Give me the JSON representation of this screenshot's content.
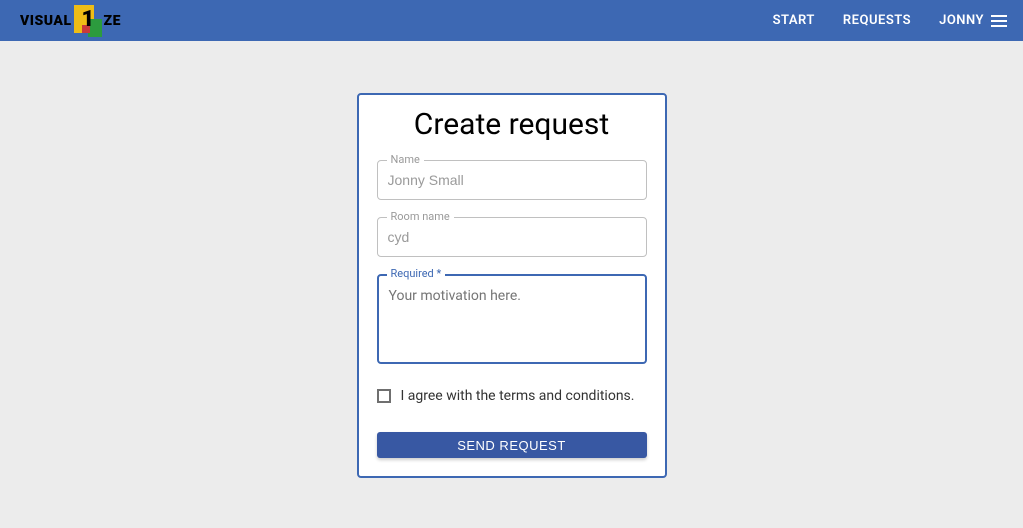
{
  "header": {
    "logo": {
      "text_left": "VISUAL",
      "one": "1",
      "text_right": "ZE"
    },
    "nav": {
      "start": "START",
      "requests": "REQUESTS",
      "user": "JONNY"
    }
  },
  "form": {
    "title": "Create request",
    "name": {
      "label": "Name",
      "value": "Jonny Small"
    },
    "room": {
      "label": "Room name",
      "value": "cyd"
    },
    "required": {
      "label": "Required *",
      "placeholder": "Your motivation here."
    },
    "terms_label": "I agree with the terms and conditions.",
    "submit_label": "SEND REQUEST"
  },
  "colors": {
    "primary": "#3d68b3",
    "button": "#3858a3"
  }
}
